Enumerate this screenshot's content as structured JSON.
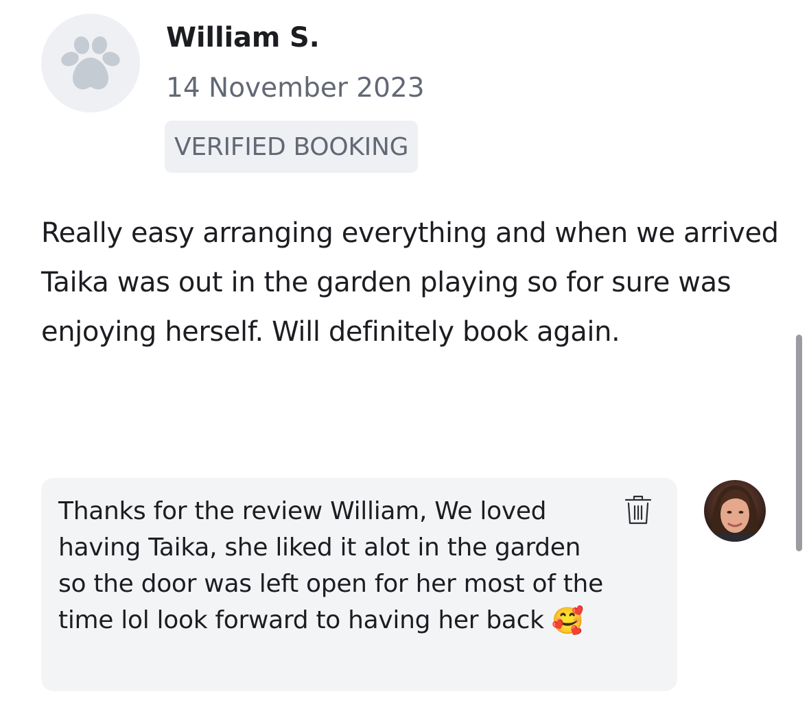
{
  "review": {
    "reviewer_avatar_icon": "paw-icon",
    "reviewer_name": "William S.",
    "date": "14 November 2023",
    "badge": "VERIFIED BOOKING",
    "text": "Really easy arranging everything and when we arrived Taika was out in the garden playing so for sure was enjoying herself. Will definitely book again."
  },
  "reply": {
    "text": "Thanks for the review William, We loved having Taika, she liked it alot in the garden so the door was left open for her most of the time lol look forward to having her back",
    "emoji": "🥰",
    "delete_icon": "trash-icon",
    "owner_avatar": "owner-photo"
  },
  "colors": {
    "text_primary": "#1c1d21",
    "text_secondary": "#626874",
    "badge_background": "#eef0f3",
    "reply_background": "#f3f4f6",
    "paw_icon": "#c5cbd3"
  }
}
